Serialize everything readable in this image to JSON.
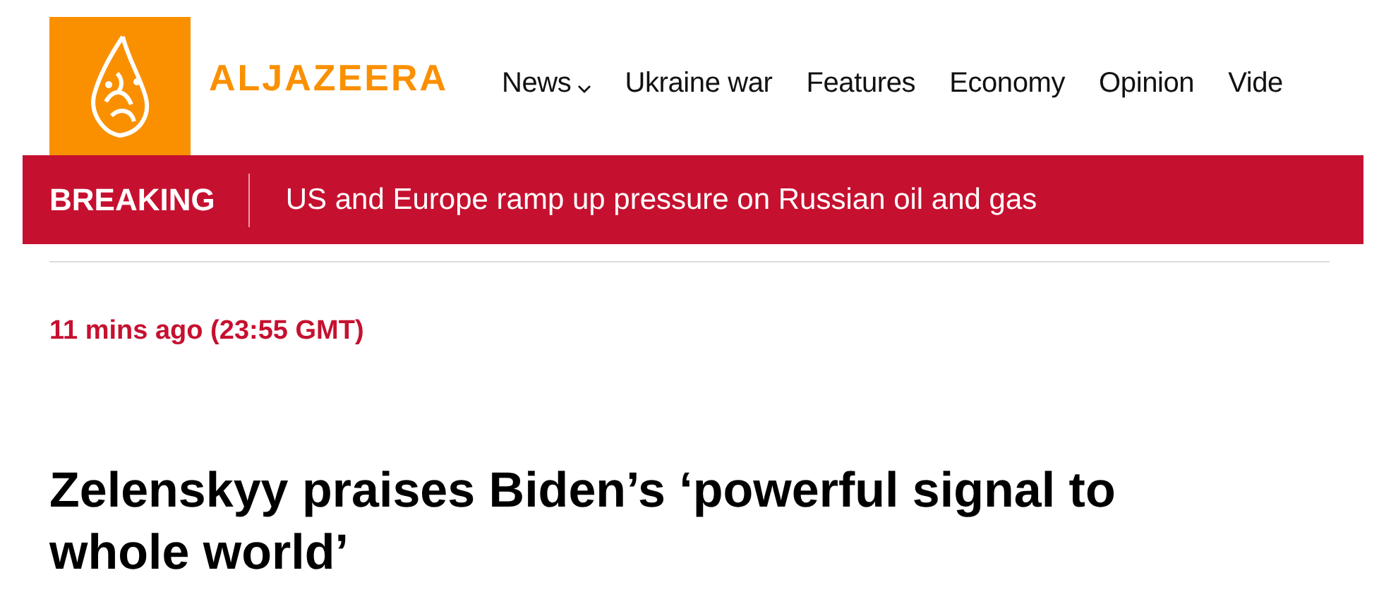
{
  "header": {
    "logo_text": "ALJAZEERA",
    "nav": [
      {
        "label": "News",
        "has_dropdown": true
      },
      {
        "label": "Ukraine war",
        "has_dropdown": false
      },
      {
        "label": "Features",
        "has_dropdown": false
      },
      {
        "label": "Economy",
        "has_dropdown": false
      },
      {
        "label": "Opinion",
        "has_dropdown": false
      },
      {
        "label": "Vide",
        "has_dropdown": false
      }
    ]
  },
  "breaking": {
    "label": "BREAKING",
    "headline": "US and Europe ramp up pressure on Russian oil and gas"
  },
  "article": {
    "timestamp": "11 mins ago (23:55 GMT)",
    "title": "Zelenskyy praises Biden’s ‘powerful signal to whole world’"
  }
}
